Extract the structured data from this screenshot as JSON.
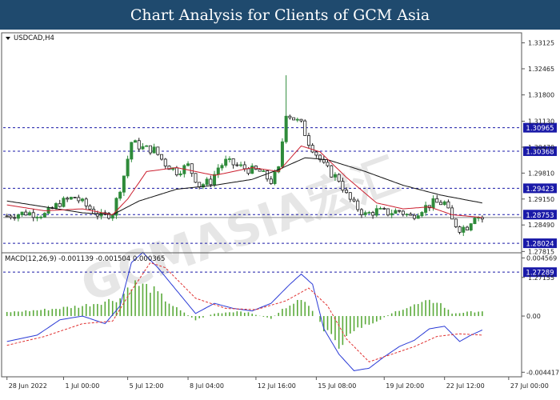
{
  "header": {
    "title": "Chart Analysis for Clients of GCM Asia"
  },
  "watermark": "GCMASIA宏汇",
  "chart_data": [
    {
      "type": "candlestick",
      "symbol_label": "USDCAD,H4",
      "ylim": [
        1.2715,
        1.3334
      ],
      "y_ticks": [
        "1.33125",
        "1.32465",
        "1.31800",
        "1.31130",
        "1.30470",
        "1.29810",
        "1.29150",
        "1.28490",
        "1.27815",
        "1.27155"
      ],
      "y_tick_values": [
        1.33125,
        1.32465,
        1.318,
        1.3113,
        1.3047,
        1.2981,
        1.2915,
        1.2849,
        1.27815,
        1.27155
      ],
      "levels": [
        {
          "label": "1.30965",
          "value": 1.30965
        },
        {
          "label": "1.30368",
          "value": 1.30368
        },
        {
          "label": "1.29423",
          "value": 1.29423
        },
        {
          "label": "1.28753",
          "value": 1.28753
        },
        {
          "label": "1.28024",
          "value": 1.28024
        },
        {
          "label": "1.27289",
          "value": 1.27289
        }
      ],
      "current_price": 1.2868,
      "ohlc_key_points": [
        [
          0,
          1.2872
        ],
        [
          5,
          1.288
        ],
        [
          10,
          1.2875
        ],
        [
          14,
          1.2905
        ],
        [
          18,
          1.292
        ],
        [
          22,
          1.289
        ],
        [
          25,
          1.287
        ],
        [
          28,
          1.288
        ],
        [
          31,
          1.2975
        ],
        [
          33,
          1.306
        ],
        [
          36,
          1.3045
        ],
        [
          39,
          1.304
        ],
        [
          42,
          1.3005
        ],
        [
          45,
          1.2985
        ],
        [
          48,
          1.3
        ],
        [
          51,
          1.295
        ],
        [
          54,
          1.296
        ],
        [
          56,
          1.2995
        ],
        [
          58,
          1.301
        ],
        [
          61,
          1.3
        ],
        [
          64,
          1.299
        ],
        [
          67,
          1.2985
        ],
        [
          70,
          1.296
        ],
        [
          72,
          1.299
        ],
        [
          74,
          1.3135
        ],
        [
          76,
          1.312
        ],
        [
          78,
          1.3105
        ],
        [
          80,
          1.306
        ],
        [
          82,
          1.303
        ],
        [
          84,
          1.3
        ],
        [
          86,
          1.298
        ],
        [
          88,
          1.2965
        ],
        [
          90,
          1.2925
        ],
        [
          92,
          1.29
        ],
        [
          95,
          1.2875
        ],
        [
          98,
          1.2885
        ],
        [
          101,
          1.288
        ],
        [
          104,
          1.2885
        ],
        [
          107,
          1.287
        ],
        [
          110,
          1.289
        ],
        [
          113,
          1.2905
        ],
        [
          116,
          1.2905
        ],
        [
          118,
          1.286
        ],
        [
          120,
          1.284
        ],
        [
          122,
          1.2845
        ],
        [
          124,
          1.2875
        ],
        [
          126,
          1.2865
        ]
      ],
      "spike_high": {
        "index": 74,
        "value": 1.323
      },
      "ma_slow_key_points": [
        [
          0,
          1.291
        ],
        [
          10,
          1.2895
        ],
        [
          20,
          1.288
        ],
        [
          28,
          1.2875
        ],
        [
          35,
          1.291
        ],
        [
          45,
          1.294
        ],
        [
          55,
          1.295
        ],
        [
          65,
          1.2965
        ],
        [
          72,
          1.299
        ],
        [
          79,
          1.302
        ],
        [
          85,
          1.3015
        ],
        [
          95,
          1.2985
        ],
        [
          105,
          1.295
        ],
        [
          115,
          1.2925
        ],
        [
          126,
          1.2905
        ]
      ],
      "ma_fast_key_points": [
        [
          0,
          1.29
        ],
        [
          10,
          1.2885
        ],
        [
          20,
          1.289
        ],
        [
          28,
          1.2875
        ],
        [
          32,
          1.2915
        ],
        [
          37,
          1.2985
        ],
        [
          45,
          1.2995
        ],
        [
          55,
          1.2975
        ],
        [
          65,
          1.2995
        ],
        [
          72,
          1.2985
        ],
        [
          78,
          1.305
        ],
        [
          83,
          1.3035
        ],
        [
          90,
          1.297
        ],
        [
          98,
          1.2905
        ],
        [
          105,
          1.289
        ],
        [
          112,
          1.2895
        ],
        [
          118,
          1.2875
        ],
        [
          126,
          1.2868
        ]
      ]
    },
    {
      "type": "macd",
      "label": "MACD(12,26,9) -0.001139 -0.001504 0.000365",
      "ylim": [
        -0.00465,
        0.00472
      ],
      "y_ticks": [
        "0.004569",
        "0.00",
        "-0.004417"
      ],
      "y_tick_values": [
        0.004569,
        0.0,
        -0.004417
      ],
      "histogram_key_points": [
        [
          0,
          0.0003
        ],
        [
          10,
          0.0005
        ],
        [
          20,
          0.0008
        ],
        [
          30,
          0.0014
        ],
        [
          33,
          0.0026
        ],
        [
          38,
          0.0022
        ],
        [
          45,
          0.0006
        ],
        [
          50,
          -0.0003
        ],
        [
          55,
          0.0002
        ],
        [
          62,
          0.0004
        ],
        [
          70,
          -0.0002
        ],
        [
          76,
          0.0012
        ],
        [
          80,
          0.001
        ],
        [
          84,
          -0.001
        ],
        [
          88,
          -0.0025
        ],
        [
          92,
          -0.0012
        ],
        [
          98,
          -0.0004
        ],
        [
          104,
          0.0005
        ],
        [
          110,
          0.001
        ],
        [
          114,
          0.0012
        ],
        [
          118,
          0.0002
        ],
        [
          122,
          0.0003
        ],
        [
          126,
          0.0004
        ]
      ],
      "macd_key_points": [
        [
          0,
          -0.002
        ],
        [
          8,
          -0.0015
        ],
        [
          14,
          -0.0003
        ],
        [
          20,
          0.0
        ],
        [
          26,
          -0.0006
        ],
        [
          30,
          0.0008
        ],
        [
          33,
          0.0042
        ],
        [
          36,
          0.005
        ],
        [
          40,
          0.0038
        ],
        [
          45,
          0.002
        ],
        [
          50,
          0.0002
        ],
        [
          55,
          0.001
        ],
        [
          60,
          0.0006
        ],
        [
          65,
          0.0004
        ],
        [
          70,
          0.001
        ],
        [
          75,
          0.0025
        ],
        [
          78,
          0.0033
        ],
        [
          81,
          0.0025
        ],
        [
          84,
          -0.001
        ],
        [
          88,
          -0.003
        ],
        [
          92,
          -0.0043
        ],
        [
          96,
          -0.0041
        ],
        [
          100,
          -0.0032
        ],
        [
          104,
          -0.0024
        ],
        [
          108,
          -0.0019
        ],
        [
          112,
          -0.001
        ],
        [
          116,
          -0.0008
        ],
        [
          120,
          -0.002
        ],
        [
          123,
          -0.0015
        ],
        [
          126,
          -0.0011
        ]
      ],
      "signal_key_points": [
        [
          0,
          -0.0023
        ],
        [
          10,
          -0.0016
        ],
        [
          20,
          -0.0006
        ],
        [
          28,
          -0.0004
        ],
        [
          33,
          0.002
        ],
        [
          38,
          0.0042
        ],
        [
          42,
          0.0038
        ],
        [
          50,
          0.0014
        ],
        [
          58,
          0.0006
        ],
        [
          66,
          0.0005
        ],
        [
          74,
          0.0012
        ],
        [
          80,
          0.0022
        ],
        [
          85,
          0.0008
        ],
        [
          90,
          -0.0018
        ],
        [
          96,
          -0.0036
        ],
        [
          102,
          -0.003
        ],
        [
          108,
          -0.0024
        ],
        [
          114,
          -0.0016
        ],
        [
          120,
          -0.0014
        ],
        [
          126,
          -0.0015
        ]
      ]
    }
  ],
  "x_ticks": [
    {
      "label": "28 Jun 2022",
      "index": 0
    },
    {
      "label": "1 Jul 00:00",
      "index": 15
    },
    {
      "label": "5 Jul 12:00",
      "index": 32
    },
    {
      "label": "8 Jul 04:00",
      "index": 48
    },
    {
      "label": "12 Jul 16:00",
      "index": 66
    },
    {
      "label": "15 Jul 08:00",
      "index": 82
    },
    {
      "label": "19 Jul 20:00",
      "index": 100
    },
    {
      "label": "22 Jul 12:00",
      "index": 116
    },
    {
      "label": "27 Jul 00:00",
      "index": 133
    }
  ],
  "x_index_range": [
    -1,
    136
  ],
  "colors": {
    "header_bg": "#1f4a6e",
    "bull_candle": "#2e8b3a",
    "bear_candle": "#1a1a1a",
    "ma_fast": "#cc2030",
    "ma_slow": "#111111",
    "level_line": "#1a1aa8",
    "level_label_bg": "#1a1aa8",
    "macd_line": "#2b3bd6",
    "signal_line": "#e03030",
    "histogram": "#5aaa3a"
  }
}
